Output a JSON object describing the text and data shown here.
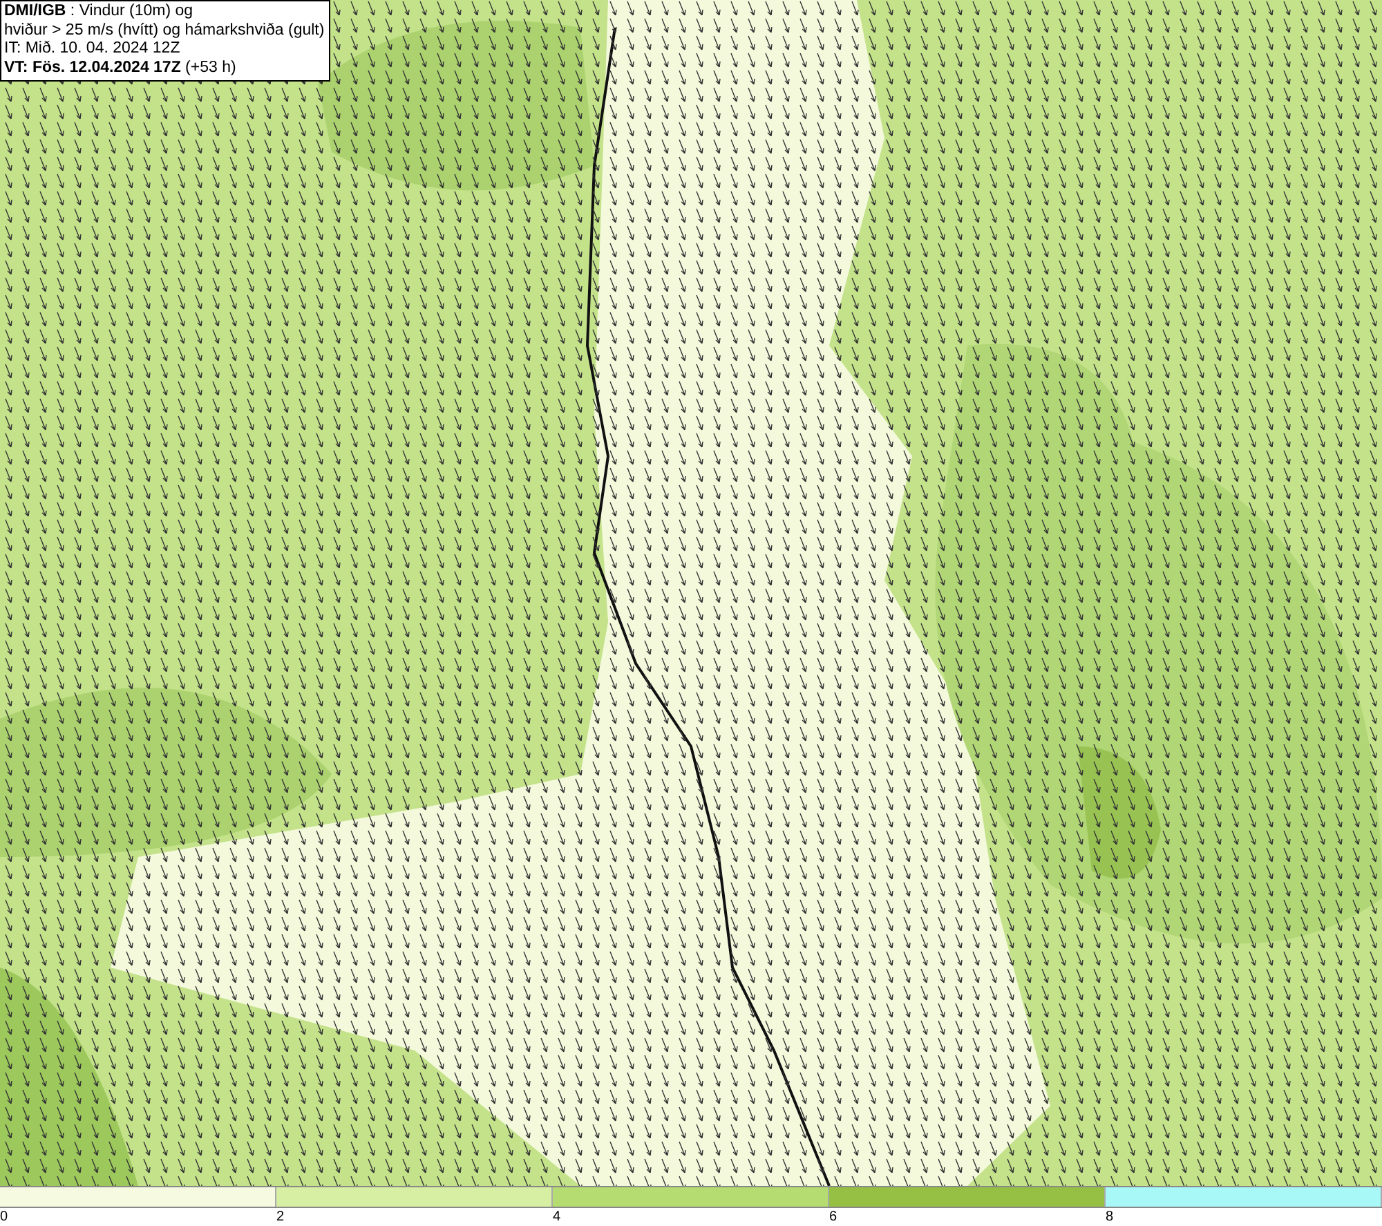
{
  "header": {
    "lines": [
      "**DMI/IGB** : Vindur (10m) og",
      "hviður > 25 m/s (hvítt) og hámarkshviða (gult)",
      "IT: Mið. 10. 04. 2024 12Z",
      "**VT: Fös. 12.04.2024 17Z** (+53 h)"
    ]
  },
  "colorbar": {
    "segments": [
      {
        "color": "#f6fae0"
      },
      {
        "color": "#d7efa3"
      },
      {
        "color": "#b5dc70"
      },
      {
        "color": "#95c044"
      },
      {
        "color": "#a8f8f8"
      }
    ],
    "ticks": [
      "0",
      "2",
      "4",
      "6",
      "8"
    ]
  }
}
